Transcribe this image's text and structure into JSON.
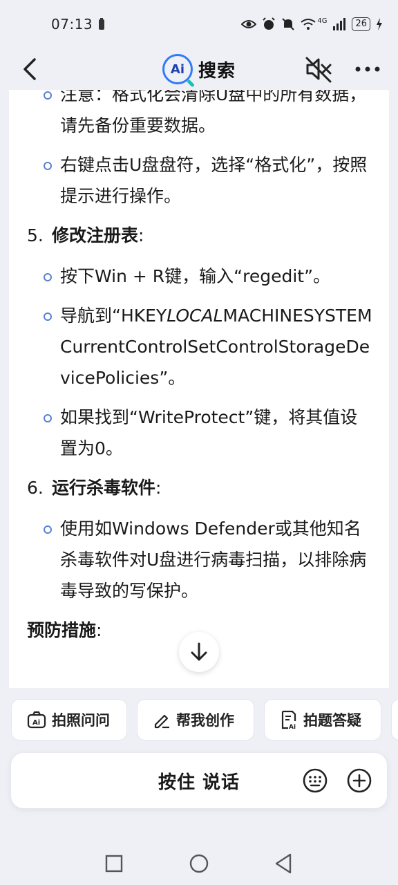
{
  "status_bar": {
    "time": "07:13",
    "battery": "26",
    "network": "4G",
    "icons": [
      "battery-small-icon",
      "eye-icon",
      "alarm-icon",
      "bell-off-icon",
      "wifi-icon",
      "signal-icon",
      "charging-icon"
    ]
  },
  "header": {
    "logo_badge": "Ai",
    "title": "搜索",
    "icons": [
      "back-arrow-icon",
      "speaker-muted-icon",
      "more-dots-icon"
    ]
  },
  "content": {
    "items": [
      {
        "type": "bullet",
        "text": "注意：格式化会清除U盘中的所有数据，请先备份重要数据。"
      },
      {
        "type": "bullet",
        "text": "右键点击U盘盘符，选择“格式化”，按照提示进行操作。"
      },
      {
        "type": "numbered",
        "num": "5.",
        "title": "修改注册表",
        "suffix": ":"
      },
      {
        "type": "bullet",
        "text": "按下Win + R键，输入“regedit”。"
      },
      {
        "type": "bullet",
        "text_parts": [
          "导航到“HKEY",
          "LOCAL",
          "MACHINESYSTEMCurrentControlSetControlStorageDevicePolicies”。"
        ]
      },
      {
        "type": "bullet",
        "text": "如果找到“WriteProtect”键，将其值设置为0。"
      },
      {
        "type": "numbered",
        "num": "6.",
        "title": "运行杀毒软件",
        "suffix": ":"
      },
      {
        "type": "bullet",
        "text": "使用如Windows Defender或其他知名杀毒软件对U盘进行病毒扫描，以排除病毒导致的写保护。"
      },
      {
        "type": "section",
        "title": "预防措施",
        "suffix": ":"
      }
    ]
  },
  "quick_actions": [
    {
      "label": "拍照问问",
      "icon": "camera-ai-icon"
    },
    {
      "label": "帮我创作",
      "icon": "pen-icon"
    },
    {
      "label": "拍题答疑",
      "icon": "document-ai-icon"
    }
  ],
  "voice_bar": {
    "label": "按住 说话",
    "icons": [
      "keyboard-icon",
      "plus-circle-icon"
    ]
  },
  "nav_bar": {
    "icons": [
      "recent-apps-icon",
      "home-icon",
      "back-triangle-icon"
    ]
  }
}
